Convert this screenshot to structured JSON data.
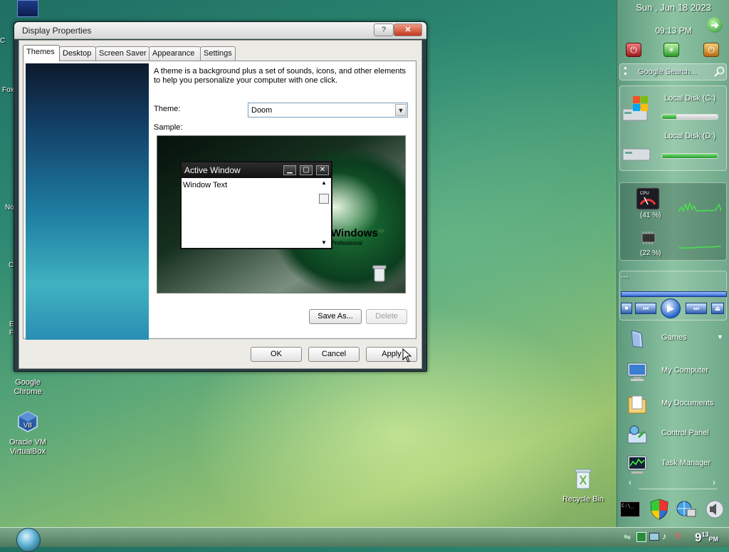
{
  "desktop": {
    "icons": [
      {
        "label1": "Google",
        "label2": "Chrome"
      },
      {
        "label1": "Oracle VM",
        "label2": "VirtualBox"
      },
      {
        "label1": "Recycle Bin",
        "label2": ""
      }
    ],
    "clipped_labels": [
      "C",
      "Fox",
      "M",
      "F",
      "Not",
      "C",
      "EV",
      "Fi"
    ]
  },
  "dialog": {
    "title": "Display Properties",
    "help_label": "?",
    "close_label": "✕",
    "tabs": [
      {
        "label": "Themes",
        "active": true
      },
      {
        "label": "Desktop",
        "active": false
      },
      {
        "label": "Screen Saver",
        "active": false
      },
      {
        "label": "Appearance",
        "active": false
      },
      {
        "label": "Settings",
        "active": false
      }
    ],
    "description": "A theme is a background plus a set of sounds, icons, and other elements to help you personalize your computer with one click.",
    "theme_label": "Theme:",
    "theme_value": "Doom",
    "sample_label": "Sample:",
    "preview": {
      "window_title": "Active Window",
      "window_text": "Window Text",
      "logo_text": "Windows",
      "logo_sup": "xp",
      "logo_sub": "Professional"
    },
    "save_as_label": "Save As...",
    "delete_label": "Delete",
    "ok_label": "OK",
    "cancel_label": "Cancel",
    "apply_label": "Apply"
  },
  "sidebar": {
    "date": "Sun , Jun 18 2023",
    "time": "09:13 PM",
    "search_placeholder": "Google Search...",
    "disks": [
      {
        "label": "Local Disk (C:)",
        "fill": 0.25
      },
      {
        "label": "Local Disk (D:)",
        "fill": 1.0
      }
    ],
    "cpu_percent": "(41 %)",
    "ram_percent": "(22 %)",
    "media_label": "---",
    "launcher": [
      {
        "label": "Games",
        "icon": "games-icon"
      },
      {
        "label": "My Computer",
        "icon": "computer-icon"
      },
      {
        "label": "My Documents",
        "icon": "documents-icon"
      },
      {
        "label": "Control Panel",
        "icon": "control-panel-icon"
      },
      {
        "label": "Task Manager",
        "icon": "task-manager-icon"
      }
    ]
  },
  "taskbar": {
    "clock_hour": "9",
    "clock_min": "13",
    "clock_ampm": "PM"
  }
}
